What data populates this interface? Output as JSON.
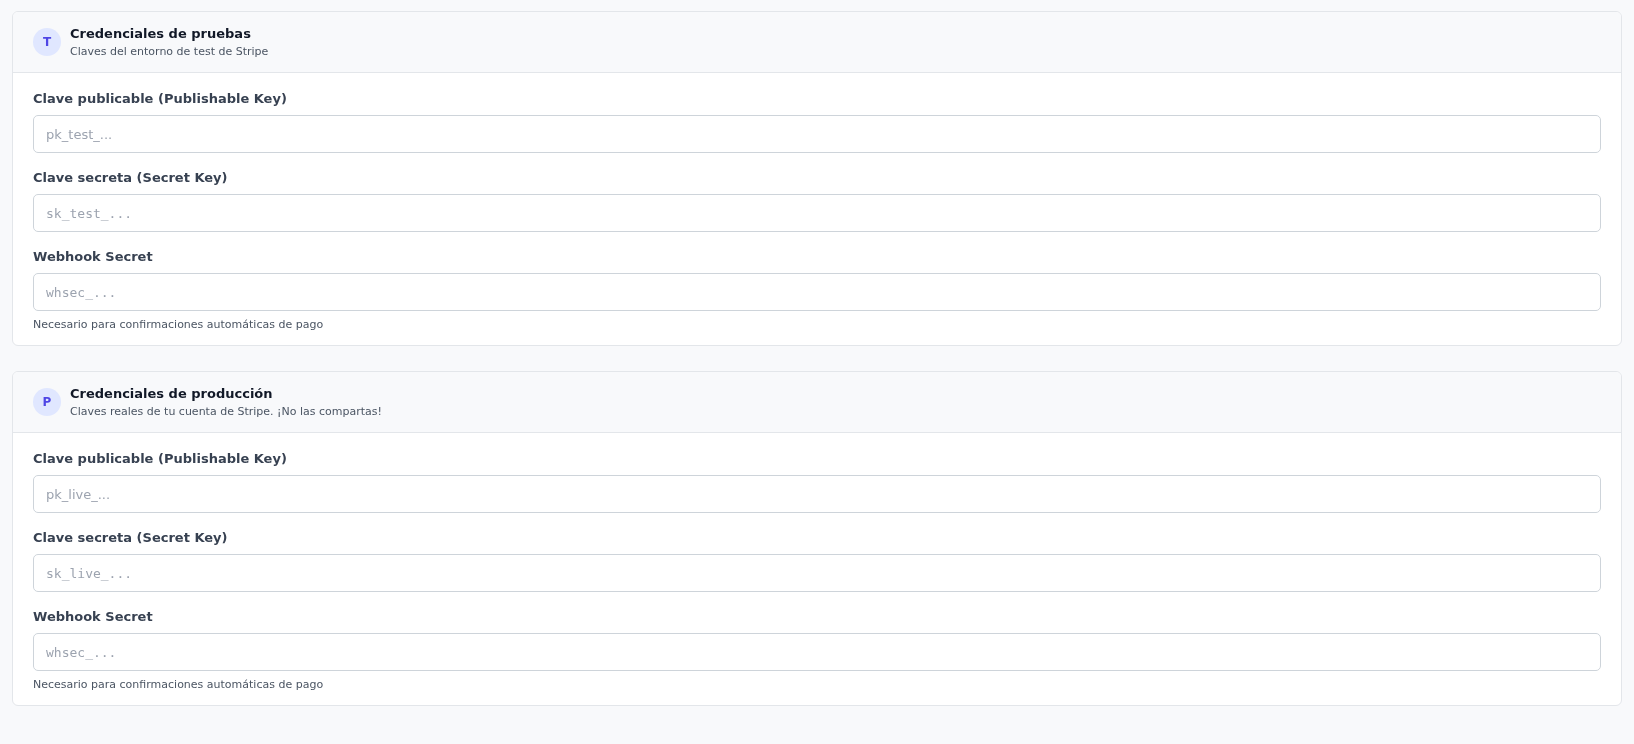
{
  "sections": [
    {
      "badge": "T",
      "title": "Credenciales de pruebas",
      "subtitle": "Claves del entorno de test de Stripe",
      "fields": [
        {
          "label": "Clave publicable (Publishable Key)",
          "placeholder": "pk_test_...",
          "kind": "text"
        },
        {
          "label": "Clave secreta (Secret Key)",
          "placeholder": "sk_test_...",
          "kind": "code"
        },
        {
          "label": "Webhook Secret",
          "placeholder": "whsec_...",
          "kind": "code",
          "hint": "Necesario para confirmaciones automáticas de pago"
        }
      ]
    },
    {
      "badge": "P",
      "title": "Credenciales de producción",
      "subtitle": "Claves reales de tu cuenta de Stripe. ¡No las compartas!",
      "fields": [
        {
          "label": "Clave publicable (Publishable Key)",
          "placeholder": "pk_live_...",
          "kind": "text"
        },
        {
          "label": "Clave secreta (Secret Key)",
          "placeholder": "sk_live_...",
          "kind": "code"
        },
        {
          "label": "Webhook Secret",
          "placeholder": "whsec_...",
          "kind": "code",
          "hint": "Necesario para confirmaciones automáticas de pago"
        }
      ]
    }
  ]
}
